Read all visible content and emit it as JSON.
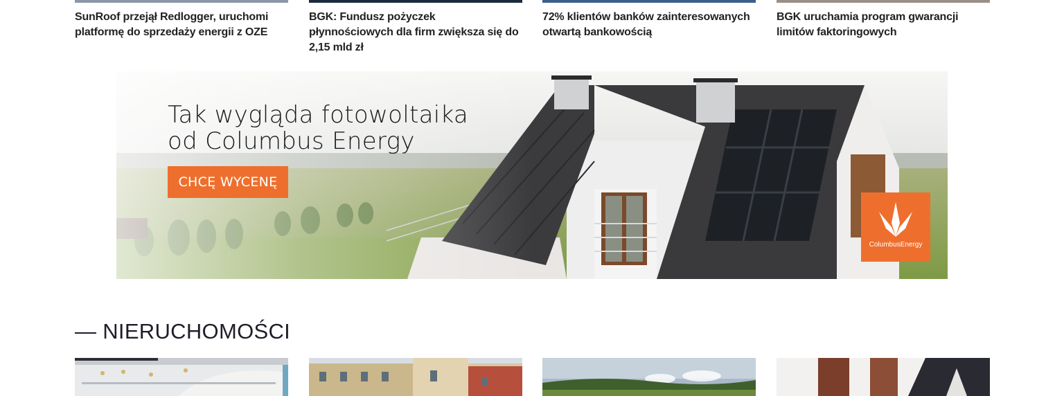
{
  "top_news": [
    {
      "title": "SunRoof przejął Redlogger, uruchomi platformę do sprzedaży energii z OZE",
      "strip_color": "#8a98a8"
    },
    {
      "title": "BGK: Fundusz pożyczek płynnościowych dla firm zwiększa się do 2,15 mld zł",
      "strip_color": "#1c2a40"
    },
    {
      "title": "72% klientów banków zainteresowanych otwartą bankowością",
      "strip_color": "#3c5f8c"
    },
    {
      "title": "BGK uruchamia program gwarancji limitów faktoringowych",
      "strip_color": "#9a8f86"
    }
  ],
  "banner": {
    "headline": "Tak wygląda fotowoltaika\nod Columbus Energy",
    "cta_label": "CHCĘ WYCENĘ",
    "logo_text": "ColumbusEnergy",
    "accent_color": "#ee6f2d"
  },
  "section": {
    "heading": "— NIERUCHOMOŚCI"
  }
}
